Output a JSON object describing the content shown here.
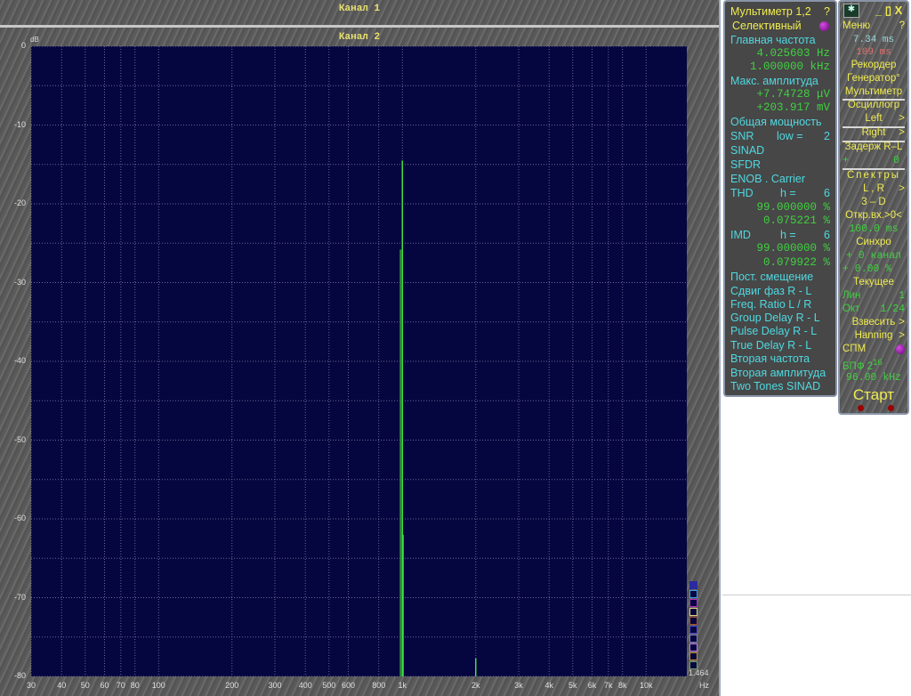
{
  "channel1_title": "Канал 1",
  "channel2_title": "Канал 2",
  "chart_data": {
    "type": "line",
    "ylabel": "dB",
    "xlabel": "Hz",
    "ylim": [
      -80,
      0
    ],
    "xlim": [
      30,
      15000
    ],
    "xscale": "log",
    "yticks": [
      "0",
      "-10",
      "-20",
      "-30",
      "-40",
      "-50",
      "-60",
      "-70",
      "-80"
    ],
    "xticks": [
      "30",
      "40",
      "50",
      "60",
      "70",
      "80",
      "100",
      "200",
      "300",
      "400",
      "500",
      "600",
      "800",
      "1k",
      "2k",
      "3k",
      "4k",
      "5k",
      "6k",
      "7k",
      "8k",
      "10k"
    ],
    "grid": true,
    "series": [
      {
        "x": [
          1000,
          2000
        ],
        "y": [
          -14.5,
          -77.7
        ]
      }
    ],
    "corner_value": "1.464"
  },
  "multimeter": {
    "title": "Мультиметр 1,2",
    "help": "?",
    "mode": "Селективный",
    "main_freq_label": "Главная частота",
    "main_freq_1": "4.025603 Hz",
    "main_freq_2": "1.000000 kHz",
    "max_amp_label": "Макс. амплитуда",
    "max_amp_1": "+7.74728 μV",
    "max_amp_2": "+203.917 mV",
    "total_power": "Общая мощность",
    "snr": "SNR",
    "snr_low": "low =",
    "snr_low_val": "2",
    "sinad": "SINAD",
    "sfdr": "SFDR",
    "enob": "ENOB . Carrier",
    "thd": "THD",
    "thd_h": "h =",
    "thd_h_val": "6",
    "thd_1": "99.000000 %",
    "thd_2": "0.075221 %",
    "imd": "IMD",
    "imd_h": "h =",
    "imd_h_val": "6",
    "imd_1": "99.000000 %",
    "imd_2": "0.079922 %",
    "items": [
      "Пост. смещение",
      "Сдвиг фаз R - L",
      "Freq. Ratio  L / R",
      "Group Delay R - L",
      "Pulse Delay R - L",
      "True Delay R - L",
      "Вторая частота",
      "Вторая амплитуда",
      "Two Tones SINAD"
    ]
  },
  "control": {
    "min": "_",
    "max": "▯",
    "close": "X",
    "menu": "Меню",
    "help": "?",
    "time1": "7.34 ms",
    "time2": "109 ms",
    "recorder": "Рекордер",
    "generator": "Генератор°",
    "multimeter": "Мультиметр",
    "oscillograph": "Осциллогр",
    "left": "Left",
    "right": "Right",
    "arrow": ">",
    "delay": "Задерж  R–L",
    "delay_sign": "+",
    "delay_val": "0",
    "spectra": "Спектры",
    "lr": "L , R",
    "three_d": "3 – D",
    "open_input": "Откр.вх.>0<",
    "open_input_val": "100.0 ms",
    "sync": "Синхро",
    "sync_ch": "+  0 канал",
    "sync_pct": "+  0.00 %",
    "current": "Текущее",
    "lin": "Лин",
    "lin_val": "1",
    "oct": "Окт",
    "oct_val": "1/24",
    "weigh": "Взвесить",
    "window": "Hanning",
    "spm": "СПМ",
    "fft": "БПФ  2",
    "fft_exp": "16",
    "sample_rate": "96.00 kHz",
    "start": "Старт"
  }
}
